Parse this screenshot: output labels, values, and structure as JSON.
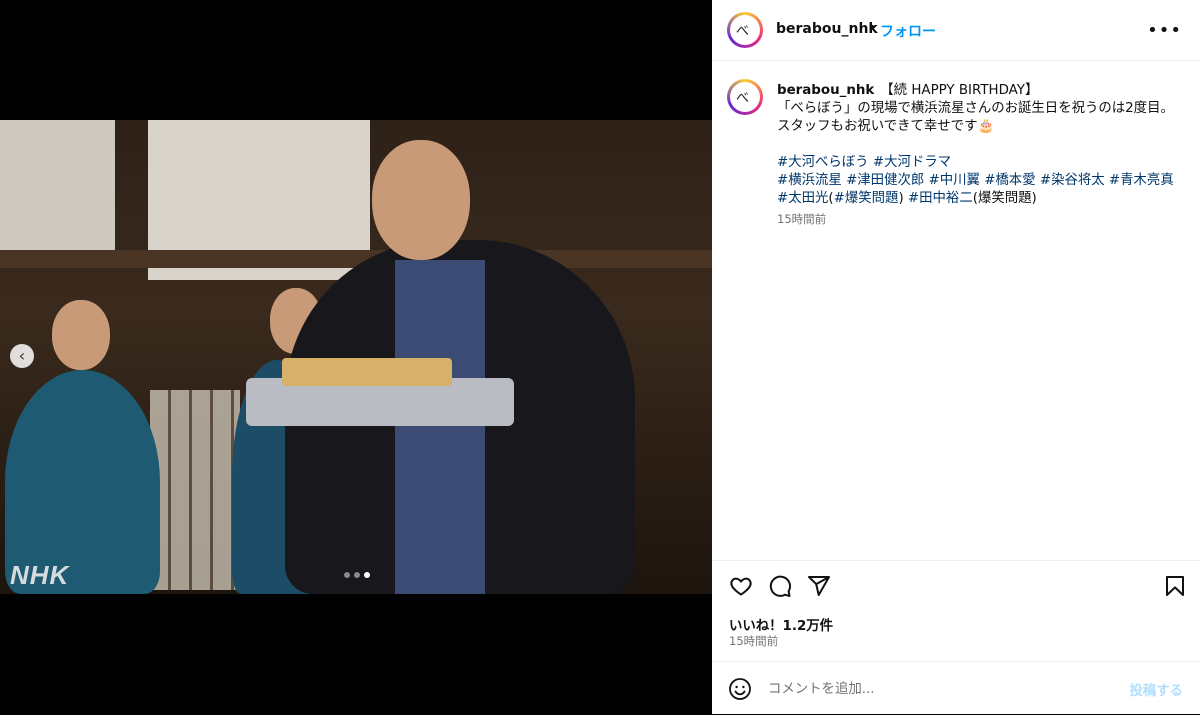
{
  "media": {
    "watermark": "NHK",
    "carousel": {
      "count": 3,
      "active_index": 2
    },
    "prev_icon": "chevron-left-icon"
  },
  "header": {
    "username": "berabou_nhk",
    "separator": "•",
    "follow_label": "フォロー",
    "more_icon": "more-horizontal-icon",
    "more_glyph": "•••"
  },
  "caption": {
    "username": "berabou_nhk",
    "line1": "【続 HAPPY BIRTHDAY】",
    "line2": "「べらぼう」の現場で横浜流星さんのお誕生日を祝うのは2度目。スタッフもお祝いできて幸せです🎂",
    "tags": [
      {
        "text": "#大河べらぼう",
        "link": true
      },
      {
        "text": " ",
        "link": false
      },
      {
        "text": "#大河ドラマ",
        "link": true
      },
      {
        "text": "\n",
        "link": false
      },
      {
        "text": "#横浜流星",
        "link": true
      },
      {
        "text": " ",
        "link": false
      },
      {
        "text": "#津田健次郎",
        "link": true
      },
      {
        "text": " ",
        "link": false
      },
      {
        "text": "#中川翼",
        "link": true
      },
      {
        "text": " ",
        "link": false
      },
      {
        "text": "#橋本愛",
        "link": true
      },
      {
        "text": " ",
        "link": false
      },
      {
        "text": "#染谷将太",
        "link": true
      },
      {
        "text": " ",
        "link": false
      },
      {
        "text": "#青木亮真",
        "link": true
      },
      {
        "text": " ",
        "link": false
      },
      {
        "text": "#太田光",
        "link": true
      },
      {
        "text": "(",
        "link": false
      },
      {
        "text": "#爆笑問題",
        "link": true
      },
      {
        "text": ") ",
        "link": false
      },
      {
        "text": "#田中裕二",
        "link": true
      },
      {
        "text": "(爆笑問題)",
        "link": false
      }
    ],
    "time": "15時間前"
  },
  "actions": {
    "likes": "いいね！1.2万件",
    "time": "15時間前"
  },
  "comment": {
    "placeholder": "コメントを追加...",
    "post_label": "投稿する"
  },
  "colors": {
    "link": "#00376b",
    "follow": "#0095f6",
    "post_disabled": "#b2dffc"
  }
}
